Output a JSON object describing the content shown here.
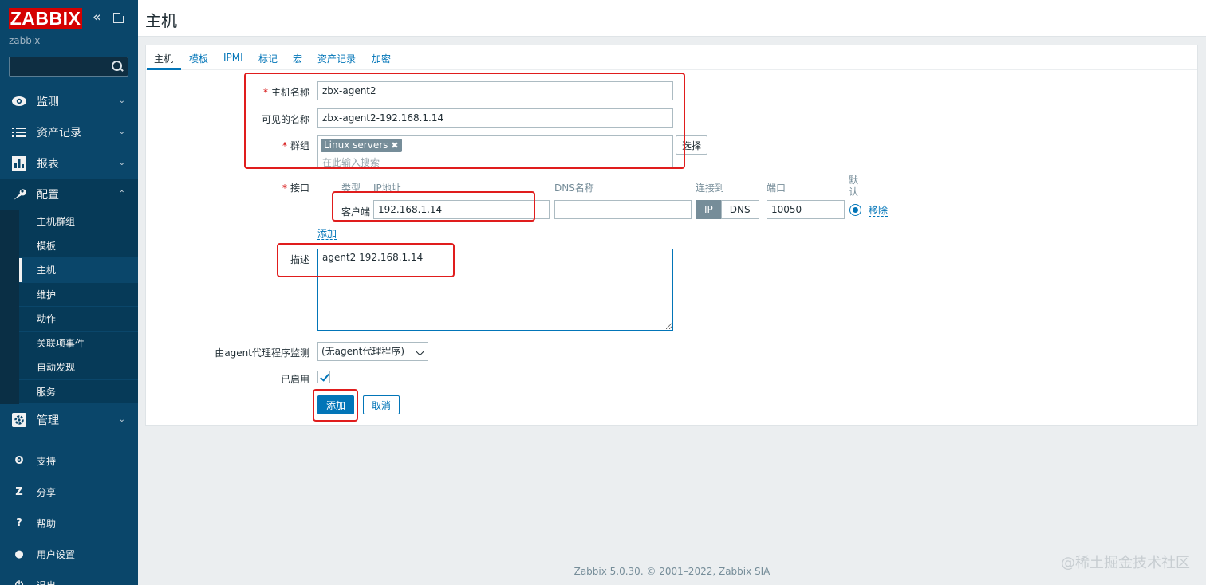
{
  "app": {
    "logo": "ZABBIX",
    "server_name": "zabbix",
    "search_placeholder": ""
  },
  "sidebar": {
    "menu": [
      {
        "label": "监测",
        "icon": "eye-icon"
      },
      {
        "label": "资产记录",
        "icon": "list-icon"
      },
      {
        "label": "报表",
        "icon": "bar-chart-icon"
      },
      {
        "label": "配置",
        "icon": "wrench-icon"
      },
      {
        "label": "管理",
        "icon": "gear-icon"
      }
    ],
    "config_sub": [
      {
        "label": "主机群组"
      },
      {
        "label": "模板"
      },
      {
        "label": "主机"
      },
      {
        "label": "维护"
      },
      {
        "label": "动作"
      },
      {
        "label": "关联项事件"
      },
      {
        "label": "自动发现"
      },
      {
        "label": "服务"
      }
    ],
    "bottom": [
      {
        "label": "支持",
        "icon": "headset-icon",
        "glyph": "ʘ"
      },
      {
        "label": "分享",
        "icon": "share-icon",
        "glyph": "Z"
      },
      {
        "label": "帮助",
        "icon": "help-icon",
        "glyph": "?"
      },
      {
        "label": "用户设置",
        "icon": "user-icon",
        "glyph": "●"
      },
      {
        "label": "退出",
        "icon": "logout-icon",
        "glyph": "⏻"
      }
    ]
  },
  "header": {
    "title": "主机"
  },
  "tabs": [
    "主机",
    "模板",
    "IPMI",
    "标记",
    "宏",
    "资产记录",
    "加密"
  ],
  "form": {
    "host_name_label": "主机名称",
    "host_name_value": "zbx-agent2",
    "visible_name_label": "可见的名称",
    "visible_name_value": "zbx-agent2-192.168.1.14",
    "groups_label": "群组",
    "group_chip": "Linux servers",
    "groups_placeholder": "在此输入搜索",
    "select_button": "选择",
    "interfaces_label": "接口",
    "iface_headers": {
      "type": "类型",
      "ip": "IP地址",
      "dns": "DNS名称",
      "connect": "连接到",
      "port": "端口",
      "default": "默认"
    },
    "iface": {
      "type": "客户端",
      "ip": "192.168.1.14",
      "dns": "",
      "connect_ip": "IP",
      "connect_dns": "DNS",
      "port": "10050",
      "remove": "移除"
    },
    "add_link": "添加",
    "description_label": "描述",
    "description_value": "agent2 192.168.1.14",
    "proxy_label": "由agent代理程序监测",
    "proxy_value": "(无agent代理程序)",
    "enabled_label": "已启用",
    "add_button": "添加",
    "cancel_button": "取消"
  },
  "footer": "Zabbix 5.0.30. © 2001–2022, Zabbix SIA",
  "watermark": "@稀土掘金技术社区",
  "colors": {
    "sidebar_bg": "#0a466a",
    "accent": "#0275b8",
    "logo_red": "#d40000",
    "annotation_red": "#e01d1d"
  }
}
